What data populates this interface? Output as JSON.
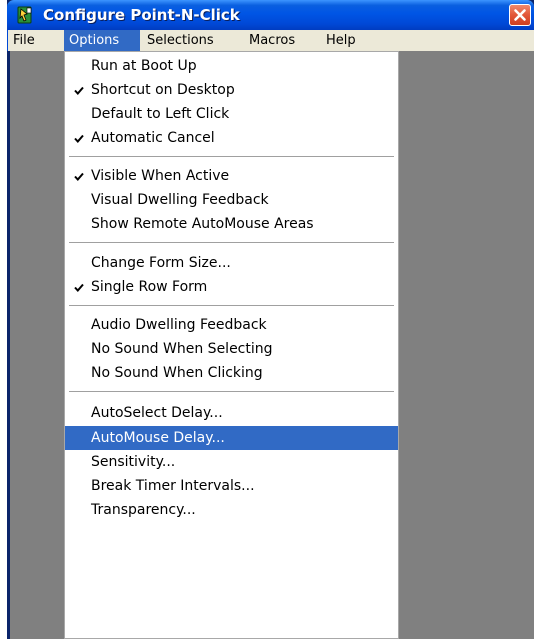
{
  "window": {
    "title": "Configure Point-N-Click",
    "close_glyph": "✕",
    "icon": "point-n-click-app-icon"
  },
  "menubar": {
    "items": [
      {
        "label": "File",
        "active": false
      },
      {
        "label": "Options",
        "active": true
      },
      {
        "label": "Selections",
        "active": false
      },
      {
        "label": "Macros",
        "active": false
      },
      {
        "label": "Help",
        "active": false
      }
    ]
  },
  "options_menu": {
    "groups": [
      [
        {
          "label": "Run at Boot Up",
          "checked": false
        },
        {
          "label": "Shortcut on Desktop",
          "checked": true
        },
        {
          "label": "Default to Left Click",
          "checked": false
        },
        {
          "label": "Automatic Cancel",
          "checked": true
        }
      ],
      [
        {
          "label": "Visible When Active",
          "checked": true
        },
        {
          "label": "Visual Dwelling Feedback",
          "checked": false
        },
        {
          "label": "Show Remote AutoMouse Areas",
          "checked": false
        }
      ],
      [
        {
          "label": "Change Form Size...",
          "checked": false
        },
        {
          "label": "Single Row Form",
          "checked": true
        }
      ],
      [
        {
          "label": "Audio Dwelling Feedback",
          "checked": false
        },
        {
          "label": "No Sound When Selecting",
          "checked": false
        },
        {
          "label": "No Sound When Clicking",
          "checked": false
        }
      ],
      [
        {
          "label": "AutoSelect Delay...",
          "checked": false
        },
        {
          "label": "AutoMouse Delay...",
          "checked": false,
          "highlighted": true
        },
        {
          "label": "Sensitivity...",
          "checked": false
        },
        {
          "label": "Break Timer Intervals...",
          "checked": false
        },
        {
          "label": "Transparency...",
          "checked": false
        }
      ]
    ]
  },
  "colors": {
    "title_bar": "#0055e5",
    "menu_highlight": "#316ac5",
    "menubar_bg": "#ece9d8",
    "client_bg": "#808080",
    "close_button": "#e2573a"
  }
}
